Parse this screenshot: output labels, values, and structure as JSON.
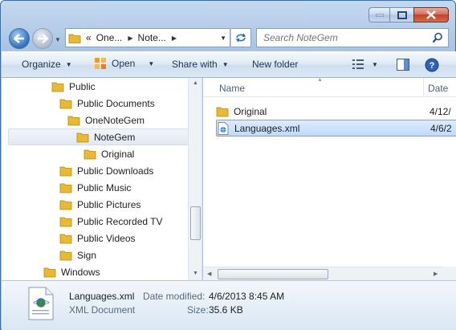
{
  "window": {
    "buttons": {
      "minimize": "minimize",
      "maximize": "maximize",
      "close": "close"
    }
  },
  "address": {
    "chevrons": "«",
    "segments": [
      "One...",
      "Note..."
    ],
    "search_placeholder": "Search NoteGem"
  },
  "toolbar": {
    "organize": "Organize",
    "open": "Open",
    "share_with": "Share with",
    "new_folder": "New folder"
  },
  "nav_tree": [
    {
      "label": "Public",
      "indent": 0
    },
    {
      "label": "Public Documents",
      "indent": 1
    },
    {
      "label": "OneNoteGem",
      "indent": 2
    },
    {
      "label": "NoteGem",
      "indent": 3,
      "selected": true
    },
    {
      "label": "Original",
      "indent": 4
    },
    {
      "label": "Public Downloads",
      "indent": 1
    },
    {
      "label": "Public Music",
      "indent": 1
    },
    {
      "label": "Public Pictures",
      "indent": 1
    },
    {
      "label": "Public Recorded TV",
      "indent": 1
    },
    {
      "label": "Public Videos",
      "indent": 1
    },
    {
      "label": "Sign",
      "indent": 1
    },
    {
      "label": "Windows",
      "indent": -1
    }
  ],
  "columns": {
    "name": "Name",
    "date": "Date"
  },
  "files": [
    {
      "name": "Original",
      "date": "4/12/",
      "type": "folder",
      "selected": false
    },
    {
      "name": "Languages.xml",
      "date": "4/6/2",
      "type": "xml",
      "selected": true
    }
  ],
  "details": {
    "filename": "Languages.xml",
    "filetype": "XML Document",
    "date_modified_label": "Date modified:",
    "date_modified_value": "4/6/2013 8:45 AM",
    "size_label": "Size:",
    "size_value": "35.6 KB"
  },
  "colors": {
    "folder": "#e8b931",
    "selection": "#c1dbfc",
    "frame": "#b7cfe9"
  }
}
